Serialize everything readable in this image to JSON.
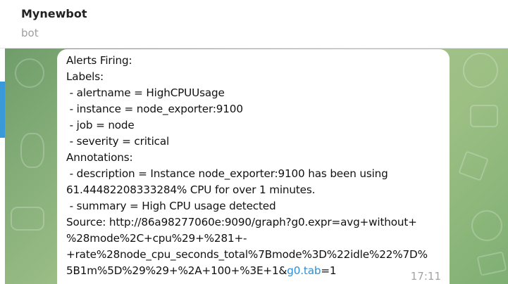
{
  "header": {
    "title": "Mynewbot",
    "subtitle": "bot"
  },
  "message": {
    "lines": [
      "Alerts Firing:",
      "Labels:",
      " - alertname = HighCPUUsage",
      " - instance = node_exporter:9100",
      " - job = node",
      " - severity = critical",
      "Annotations:",
      " - description = Instance node_exporter:9100 has been using",
      "61.44482208333284% CPU for over 1 minutes.",
      " - summary = High CPU usage detected",
      "Source: http://86a98277060e:9090/graph?g0.expr=avg+without+",
      "%28mode%2C+cpu%29+%281+-",
      "+rate%28node_cpu_seconds_total%7Bmode%3D%22idle%22%7D%",
      "5B1m%5D%29%29+%2A+100+%3E+1&"
    ],
    "link_text": "g0.tab",
    "link_suffix": "=1",
    "time": "17:11"
  },
  "colors": {
    "accent": "#3a9ad9",
    "link": "#2e8fd2",
    "chat_background": "#8fb57f",
    "bubble": "#ffffff"
  }
}
